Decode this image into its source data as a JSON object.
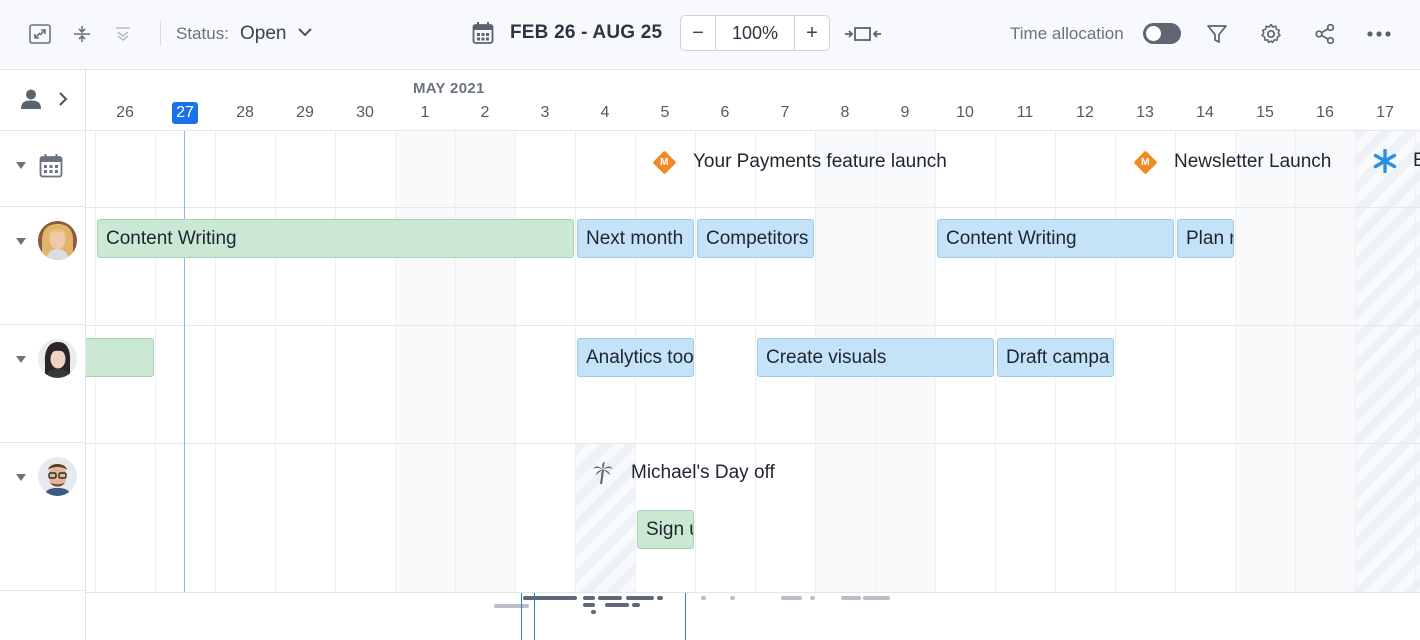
{
  "toolbar": {
    "status_label": "Status:",
    "status_value": "Open",
    "date_range": "FEB 26 - AUG 25",
    "zoom_minus": "−",
    "zoom_value": "100%",
    "zoom_plus": "+",
    "time_allocation_label": "Time allocation",
    "time_allocation_on": false,
    "icons": [
      "fullscreen-icon",
      "collapse-rows-icon",
      "expand-rows-icon",
      "calendar-icon",
      "fit-to-screen-icon",
      "filter-icon",
      "settings-icon",
      "share-icon",
      "more-icon"
    ]
  },
  "timeline": {
    "month_label": "MAY 2021",
    "days": [
      "26",
      "27",
      "28",
      "29",
      "30",
      "1",
      "2",
      "3",
      "4",
      "5",
      "6",
      "7",
      "8",
      "9",
      "10",
      "11",
      "12",
      "13",
      "14",
      "15",
      "16",
      "17"
    ],
    "today": "27",
    "today_color": "#1a73e8"
  },
  "milestones": [
    {
      "badge": "M",
      "label": "Your Payments feature launch"
    },
    {
      "badge": "M",
      "label": "Newsletter Launch"
    },
    {
      "label": "E"
    }
  ],
  "rows": [
    {
      "tasks": [
        "Content Writing",
        "Next month",
        "Competitors",
        "Content Writing",
        "Plan r"
      ]
    },
    {
      "tasks": [
        "",
        "Analytics too",
        "Create visuals",
        "Draft campa"
      ]
    },
    {
      "time_off": "Michael's Day off",
      "tasks": [
        "Sign u"
      ]
    }
  ],
  "colors": {
    "green_task": "#cbe8d4",
    "blue_task": "#c4e3f8",
    "milestone": "#f08a24",
    "event_star": "#2b8fe0"
  }
}
